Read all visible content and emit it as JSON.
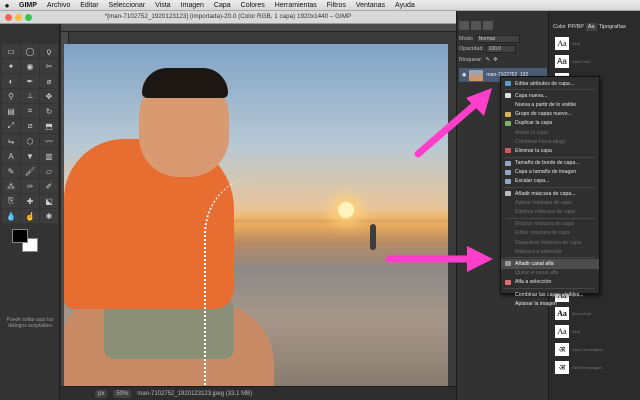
{
  "menubar": {
    "app": "GIMP",
    "items": [
      "Archivo",
      "Editar",
      "Seleccionar",
      "Vista",
      "Imagen",
      "Capa",
      "Colores",
      "Herramientas",
      "Filtros",
      "Ventanas",
      "Ayuda"
    ]
  },
  "window": {
    "title": "*[man-7102752_1920123123] (importada)-20.0 (Color RGB, 1 capa) 1920x1440 – GIMP"
  },
  "toolbox": {
    "hint": "Puede soltar aquí los diálogos acoplables"
  },
  "statusbar": {
    "unit": "px",
    "zoom": "50%",
    "file": "man-7102752_1920123123.jpeg (33,1 MB)"
  },
  "layers_panel": {
    "mode_label": "Modo",
    "mode_value": "Normal",
    "opacity_label": "Opacidad",
    "opacity_value": "100,0",
    "lock_label": "Bloquear:",
    "layer_name": "man-7102752_192"
  },
  "fonts_panel": {
    "tabs": [
      "Color PP/BP",
      "Aa",
      "Tipografías"
    ],
    "sample": "Aa",
    "hindi_sample": "अ",
    "labels": [
      "Serif",
      "Sans Serif",
      "Serif Bold",
      "Sans Bold",
      "Serif Italic",
      "Sans Italic",
      "Mono",
      "Mono Bold",
      "Sans Devanagari",
      "Serif Devanagari"
    ]
  },
  "context_menu": {
    "items": [
      {
        "label": "Editar atributos de capa...",
        "enabled": true,
        "icon": "edit"
      },
      {
        "sep": true
      },
      {
        "label": "Capa nueva...",
        "enabled": true,
        "icon": "new"
      },
      {
        "label": "Nueva a partir de lo visible",
        "enabled": true
      },
      {
        "label": "Grupo de capas nuevo...",
        "enabled": true,
        "icon": "folder"
      },
      {
        "label": "Duplicar la capa",
        "enabled": true,
        "icon": "dup"
      },
      {
        "label": "Anclar la capa",
        "enabled": false
      },
      {
        "label": "Combinar hacia abajo",
        "enabled": false
      },
      {
        "label": "Eliminar la capa",
        "enabled": true,
        "icon": "del"
      },
      {
        "sep": true
      },
      {
        "label": "Tamaño de borde de capa...",
        "enabled": true,
        "icon": "size"
      },
      {
        "label": "Capa a tamaño de imagen",
        "enabled": true,
        "icon": "size"
      },
      {
        "label": "Escalar capa...",
        "enabled": true,
        "icon": "scale"
      },
      {
        "sep": true
      },
      {
        "label": "Añadir máscara de capa...",
        "enabled": true,
        "icon": "mask"
      },
      {
        "label": "Aplicar máscara de capa",
        "enabled": false
      },
      {
        "label": "Eliminar máscara de capa",
        "enabled": false
      },
      {
        "sep": true
      },
      {
        "label": "Mostrar máscara de capa",
        "enabled": false
      },
      {
        "label": "Editar máscara de capa",
        "enabled": false
      },
      {
        "label": "Desactivar máscara de capa",
        "enabled": false
      },
      {
        "label": "Máscara a selección",
        "enabled": false
      },
      {
        "sep": true
      },
      {
        "label": "Añadir canal alfa",
        "enabled": true,
        "highlighted": true,
        "icon": "alpha"
      },
      {
        "label": "Quitar el canal alfa",
        "enabled": false
      },
      {
        "label": "Alfa a selección",
        "enabled": true,
        "icon": "alphasel"
      },
      {
        "sep": true
      },
      {
        "label": "Combinar las capas visibles...",
        "enabled": true
      },
      {
        "label": "Aplanar la imagen",
        "enabled": true
      }
    ]
  },
  "colors": {
    "arrow": "#ff3ec9",
    "accent": "#4a5a74"
  }
}
